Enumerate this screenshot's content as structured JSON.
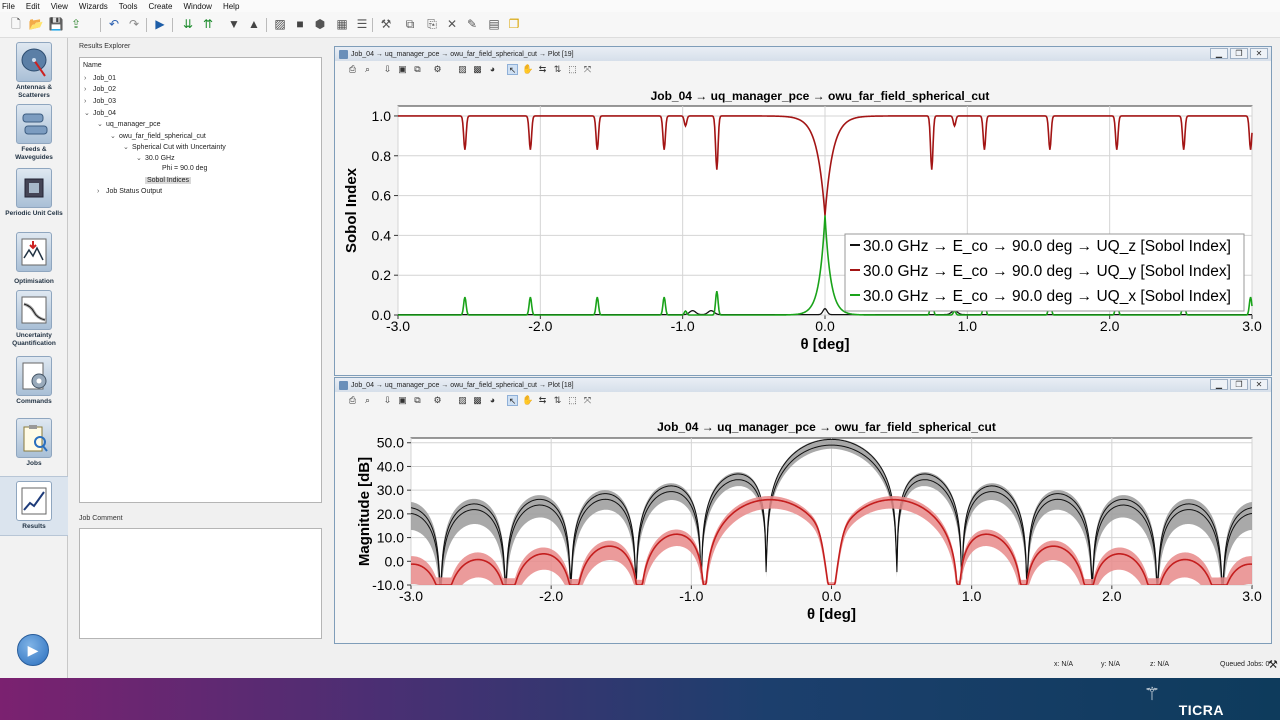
{
  "menu": [
    "File",
    "Edit",
    "View",
    "Wizards",
    "Tools",
    "Create",
    "Window",
    "Help"
  ],
  "sidebar": {
    "items": [
      {
        "label": "Antennas &\nScatterers"
      },
      {
        "label": "Feeds &\nWaveguides"
      },
      {
        "label": "Periodic Unit Cells"
      },
      {
        "label": "Optimisation"
      },
      {
        "label": "Uncertainty\nQuantification"
      },
      {
        "label": "Commands"
      },
      {
        "label": "Jobs"
      },
      {
        "label": "Results"
      }
    ]
  },
  "results_explorer": {
    "title": "Results Explorer",
    "column": "Name",
    "nodes": [
      {
        "label": "Job_01",
        "arrow": "›"
      },
      {
        "label": "Job_02",
        "arrow": "›"
      },
      {
        "label": "Job_03",
        "arrow": "›"
      },
      {
        "label": "Job_04",
        "arrow": "⌄"
      },
      {
        "label": "uq_manager_pce",
        "arrow": "⌄"
      },
      {
        "label": "owu_far_field_spherical_cut",
        "arrow": "⌄"
      },
      {
        "label": "Spherical Cut with Uncertainty",
        "arrow": "⌄"
      },
      {
        "label": "30.0 GHz",
        "arrow": "⌄"
      },
      {
        "label": "Phi = 90.0 deg",
        "arrow": ""
      },
      {
        "label": "Sobol Indices",
        "arrow": ""
      },
      {
        "label": "Job Status Output",
        "arrow": "›"
      }
    ]
  },
  "job_comment": {
    "title": "Job Comment"
  },
  "plot1": {
    "window_title": "Job_04 → uq_manager_pce → owu_far_field_spherical_cut → Plot [19]",
    "chart_data": {
      "type": "line",
      "title": "Job_04 → uq_manager_pce → owu_far_field_spherical_cut",
      "xlabel": "θ [deg]",
      "ylabel": "Sobol Index",
      "xlim": [
        -3.0,
        3.0
      ],
      "ylim": [
        0.0,
        1.05
      ],
      "xticks": [
        "-3.0",
        "-2.0",
        "-1.0",
        "0.0",
        "1.0",
        "2.0",
        "3.0"
      ],
      "yticks": [
        "0.0",
        "0.2",
        "0.4",
        "0.6",
        "0.8",
        "1.0"
      ],
      "dip_positions": [
        -2.53,
        -2.07,
        -1.6,
        -1.13,
        -0.98,
        -0.76,
        0.0,
        0.75,
        0.91,
        1.12,
        1.58,
        2.05,
        2.52,
        2.99
      ],
      "series": [
        {
          "name": "30.0 GHz → E_co → 90.0 deg → UQ_z [Sobol Index]",
          "color": "#111111",
          "baseline": 0.0,
          "peak_at_0": 0.03
        },
        {
          "name": "30.0 GHz → E_co → 90.0 deg → UQ_y [Sobol Index]",
          "color": "#a31515",
          "baseline": 1.0,
          "peak_at_0": 0.5
        },
        {
          "name": "30.0 GHz → E_co → 90.0 deg → UQ_x [Sobol Index]",
          "color": "#1aa31a",
          "baseline": 0.0,
          "peak_at_0": 0.5
        }
      ],
      "legend": "center-right",
      "grid": true
    }
  },
  "plot2": {
    "window_title": "Job_04 → uq_manager_pce → owu_far_field_spherical_cut → Plot [18]",
    "chart_data": {
      "type": "line",
      "title": "Job_04 → uq_manager_pce → owu_far_field_spherical_cut",
      "xlabel": "θ [deg]",
      "ylabel": "Magnitude [dB]",
      "xlim": [
        -3.0,
        3.0
      ],
      "ylim": [
        -10.0,
        52.0
      ],
      "xticks": [
        "-3.0",
        "-2.0",
        "-1.0",
        "0.0",
        "1.0",
        "2.0",
        "3.0"
      ],
      "yticks": [
        "-10.0",
        "0.0",
        "10.0",
        "20.0",
        "30.0",
        "40.0",
        "50.0"
      ],
      "series": [
        {
          "color": "#111111",
          "band": "#9a9a9a",
          "peak_db": 50.5,
          "null_spacing_deg": 0.465
        },
        {
          "color": "#c41e1e",
          "band": "#e88a8a",
          "peak_db": 26.0,
          "null_spacing_deg": 0.465
        }
      ],
      "grid": true
    }
  },
  "status": {
    "x": "x: N/A",
    "y": "y: N/A",
    "z": "z: N/A",
    "queued": "Queued Jobs: 0"
  },
  "brand": "TICRA"
}
